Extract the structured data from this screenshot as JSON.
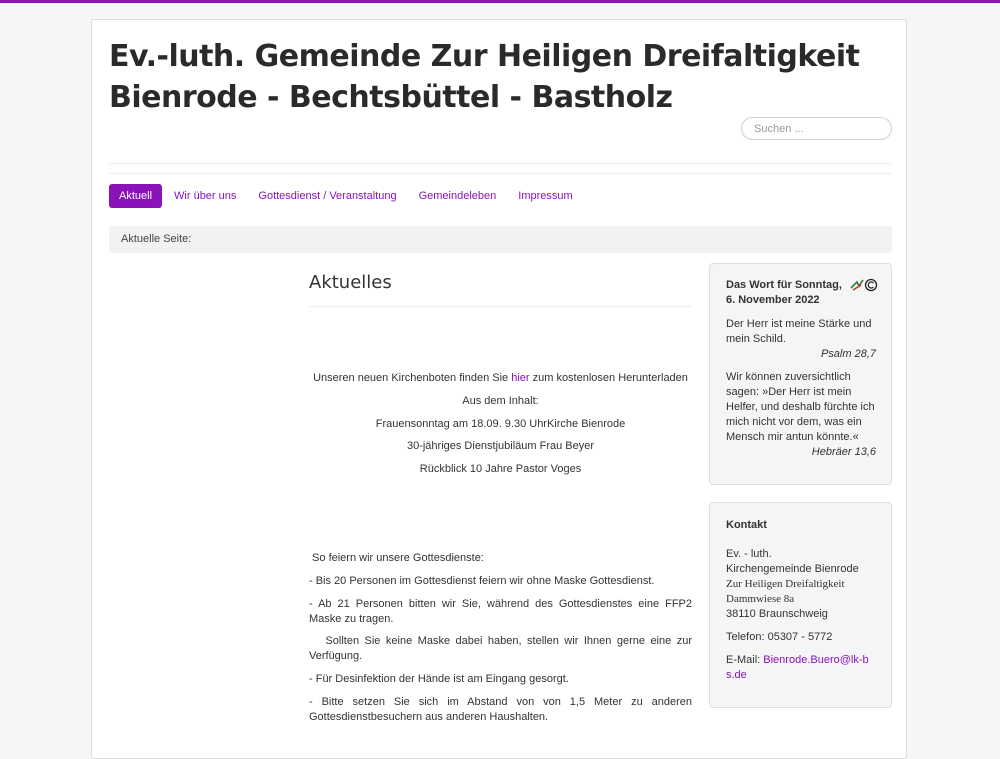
{
  "header": {
    "title_line1": "Ev.-luth. Gemeinde Zur Heiligen Dreifaltigkeit",
    "title_line2": "Bienrode - Bechtsbüttel - Bastholz",
    "search_placeholder": "Suchen ..."
  },
  "nav": {
    "items": [
      {
        "label": "Aktuell",
        "active": true
      },
      {
        "label": "Wir über uns",
        "active": false
      },
      {
        "label": "Gottesdienst / Veranstaltung",
        "active": false
      },
      {
        "label": "Gemeindeleben",
        "active": false
      },
      {
        "label": "Impressum",
        "active": false
      }
    ]
  },
  "breadcrumb": {
    "label": "Aktuelle Seite:"
  },
  "article": {
    "title": "Aktuelles",
    "kb_before": "Unseren neuen Kirchenboten finden Sie ",
    "kb_link": "hier",
    "kb_after": " zum kostenlosen Herunterladen",
    "content_heading": "Aus dem Inhalt:",
    "content_items": [
      "Frauensonntag am 18.09. 9.30 UhrKirche Bienrode",
      "30-jähriges Dienstjubiläum Frau Beyer",
      "Rückblick 10 Jahre Pastor Voges"
    ],
    "rules_heading": " So feiern wir unsere Gottesdienste:",
    "rules": [
      "- Bis 20 Personen im Gottesdienst feiern wir ohne Maske Gottesdienst.",
      "- Ab 21 Personen bitten wir Sie, während des Gottesdienstes eine FFP2 Maske zu tragen.",
      "   Sollten Sie keine Maske dabei haben, stellen wir Ihnen gerne eine zur Verfügung.",
      "- Für Desinfektion der Hände ist am Eingang gesorgt.",
      "- Bitte setzen Sie sich im Abstand von von 1,5 Meter zu anderen Gottesdienstbesuchern aus anderen Haushalten."
    ]
  },
  "sidebar": {
    "word": {
      "title": "Das Wort für Sonntag, 6. November 2022",
      "icon": "losungen-logo-icon",
      "verse1": "Der Herr ist meine Stärke und mein Schild.",
      "ref1": "Psalm 28,7",
      "verse2": "Wir können zuversichtlich sagen: »Der Herr ist mein Helfer, und deshalb fürchte ich mich nicht vor dem, was ein Mensch mir antun könnte.«",
      "ref2": "Hebräer 13,6"
    },
    "contact": {
      "title": "Kontakt",
      "line1": "Ev. - luth.",
      "line2": "Kirchengemeinde Bienrode",
      "line3": "Zur Heiligen Dreifaltigkeit",
      "line4": "Dammwiese 8a",
      "line5": "38110 Braunschweig",
      "phone": "Telefon: 05307 - 5772",
      "email_label": "E-Mail: ",
      "email": "Bienrode.Buero@lk-bs.de"
    }
  },
  "colors": {
    "accent": "#8a12b8",
    "background": "#f4f6f7"
  }
}
